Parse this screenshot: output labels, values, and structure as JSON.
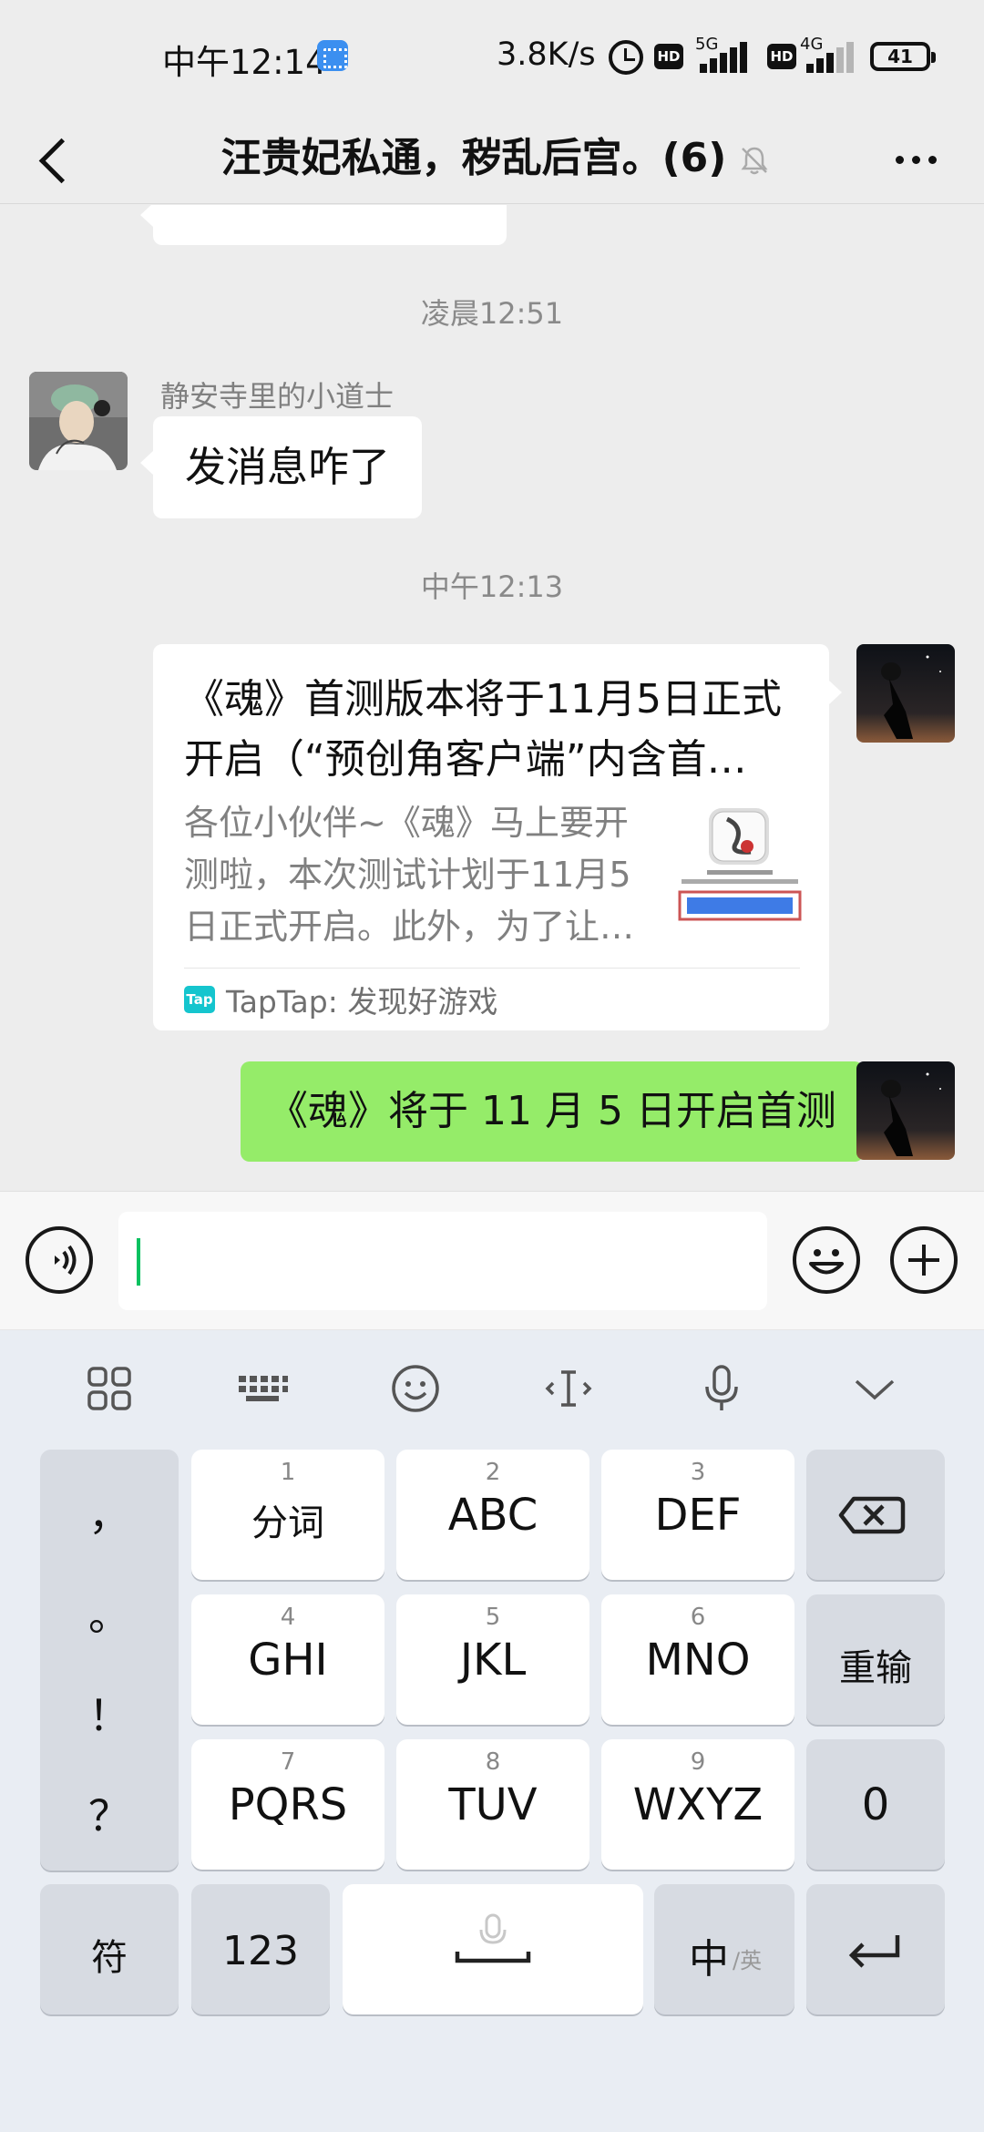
{
  "status_bar": {
    "time": "中午12:14",
    "net_speed": "3.8K/s",
    "hd1": "HD",
    "net1": "5G",
    "hd2": "HD",
    "net2": "4G",
    "battery": "41"
  },
  "header": {
    "title": "汪贵妃私通，秽乱后宫。(6)"
  },
  "chat": {
    "timestamp_1": "凌晨12:51",
    "sender_name": "静安寺里的小道士",
    "message_1": "发消息咋了",
    "timestamp_2": "中午12:13",
    "card": {
      "title": "《魂》首测版本将于11月5日正式开启（“预创角客户端”内含首…",
      "description": "各位小伙伴~《魂》马上要开测啦，本次测试计划于11月5日正式开启。此外，为了让…",
      "source": "TapTap: 发现好游戏",
      "source_icon": "Tap"
    },
    "message_2": "《魂》将于 11 月 5 日开启首测"
  },
  "input": {
    "value": "",
    "placeholder": ""
  },
  "keyboard": {
    "keys": [
      {
        "num": "1",
        "label": "分词"
      },
      {
        "num": "2",
        "label": "ABC"
      },
      {
        "num": "3",
        "label": "DEF"
      },
      {
        "num": "4",
        "label": "GHI"
      },
      {
        "num": "5",
        "label": "JKL"
      },
      {
        "num": "6",
        "label": "MNO"
      },
      {
        "num": "7",
        "label": "PQRS"
      },
      {
        "num": "8",
        "label": "TUV"
      },
      {
        "num": "9",
        "label": "WXYZ"
      }
    ],
    "punctuation": [
      "，",
      "。",
      "！",
      "？"
    ],
    "reinput": "重输",
    "zero": "0",
    "symbols": "符",
    "numbers": "123",
    "lang_main": "中",
    "lang_alt": "/英"
  },
  "colors": {
    "accent_green": "#95ec69",
    "caret": "#07c160",
    "tap_brand": "#15c5ce"
  }
}
